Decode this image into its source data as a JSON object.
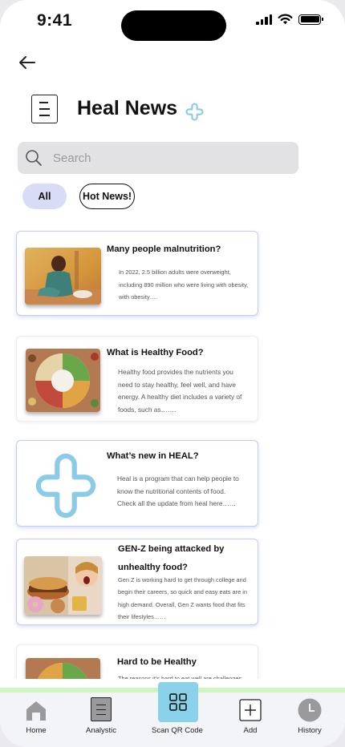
{
  "status_bar": {
    "time": "9:41"
  },
  "header": {
    "title": "Heal News"
  },
  "search": {
    "placeholder": "Search"
  },
  "filters": [
    {
      "label": "All",
      "selected": true
    },
    {
      "label": "Hot News!",
      "selected": false
    }
  ],
  "articles": [
    {
      "title": "Many people malnutrition?",
      "body": [
        "In 2022, 2.5 billion adults were overweight,",
        "including 890 million who were living with obesity,",
        "with obesity…."
      ]
    },
    {
      "title": "What is Healthy Food?",
      "body": [
        "Healthy food provides the nutrients you",
        "need to stay healthy, feel well, and have",
        "energy. A healthy diet includes a variety of",
        "foods, such as……."
      ]
    },
    {
      "title": "What’s new in HEAL?",
      "body": [
        "Heal is a program that can help people to",
        "know the nutritional contents of food.",
        "Check all the update from heal here……"
      ]
    },
    {
      "title": [
        "GEN-Z being attacked by",
        "unhealthy food?"
      ],
      "body": [
        "Gen Z is working hard to get through college and",
        "begin their careers, so quick and easy eats are in",
        "high demand. Overall, Gen Z wants food that fits",
        "their lifestyles……"
      ]
    },
    {
      "title": "Hard to be Healthy",
      "body": [
        "The reasons it's hard to eat well are challenges"
      ]
    }
  ],
  "nav": {
    "home": "Home",
    "analystic": "Analystic",
    "scan": "Scan QR Code",
    "add": "Add",
    "history": "History"
  },
  "colors": {
    "accent_blue": "#89d2ea",
    "chip_selected": "#d8dcf6",
    "card_border": "#c5cbf7",
    "tabbar_highlight": "#cdf5c4"
  },
  "icons": [
    "back-arrow-icon",
    "document-icon",
    "heal-plus-icon",
    "search-icon",
    "home-icon",
    "analystic-icon",
    "scan-qr-icon",
    "add-icon",
    "history-icon"
  ]
}
